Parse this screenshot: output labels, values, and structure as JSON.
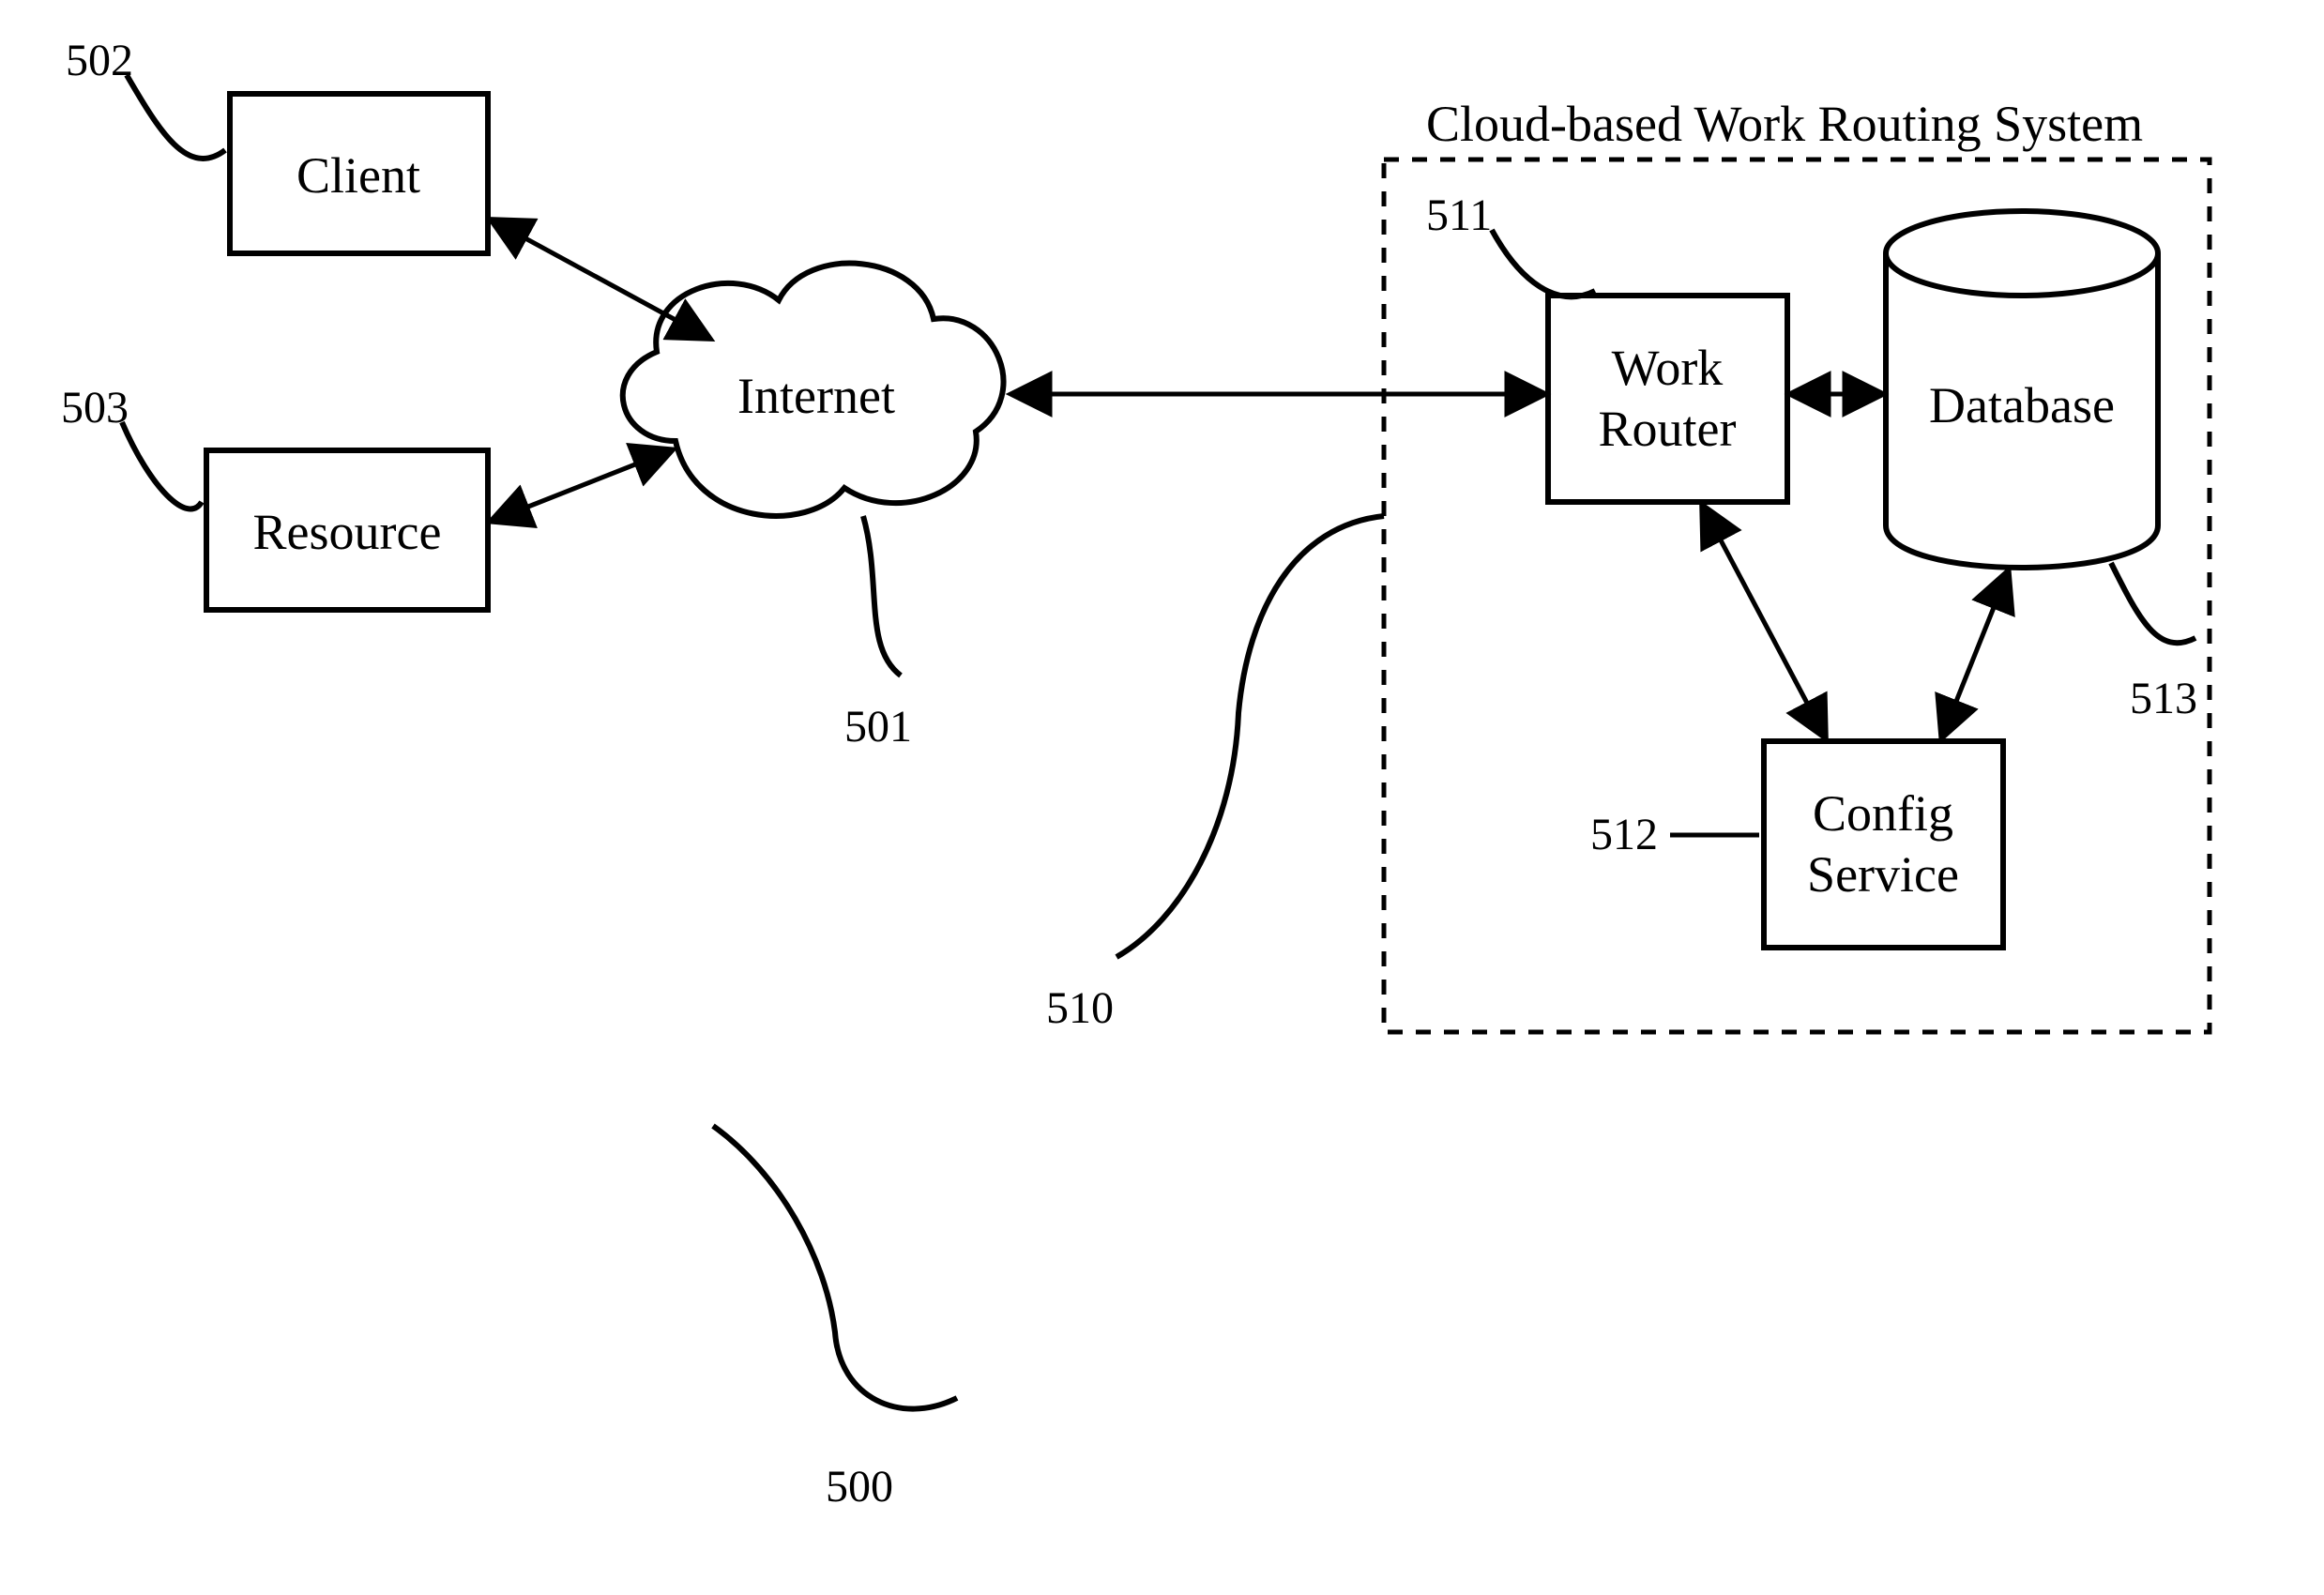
{
  "title": "Cloud-based Work Routing System",
  "nodes": {
    "client": {
      "label": "Client",
      "ref": "502"
    },
    "resource": {
      "label": "Resource",
      "ref": "503"
    },
    "internet": {
      "label": "Internet",
      "ref": "501"
    },
    "work_router": {
      "label_line1": "Work",
      "label_line2": "Router",
      "ref": "511"
    },
    "config_service": {
      "label_line1": "Config",
      "label_line2": "Service",
      "ref": "512"
    },
    "database": {
      "label": "Database",
      "ref": "513"
    }
  },
  "system_ref": "510",
  "overall_ref": "500"
}
